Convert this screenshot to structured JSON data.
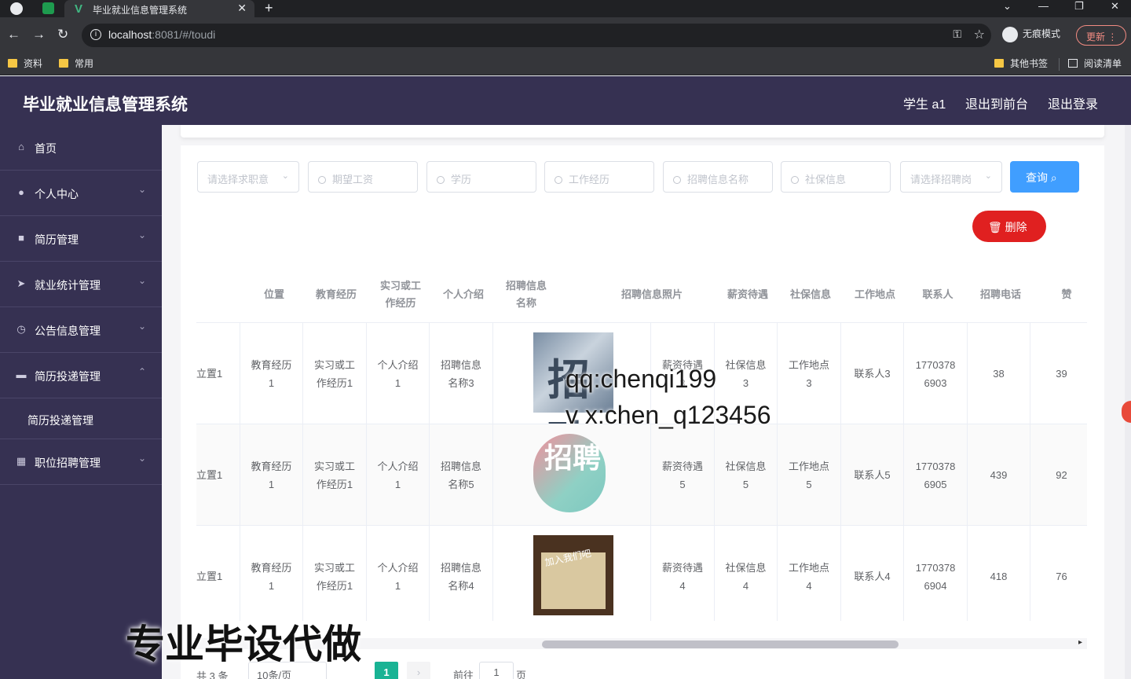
{
  "browser": {
    "tab_title": "毕业就业信息管理系统",
    "url_host": "localhost",
    "url_rest": ":8081/#/toudi",
    "incognito_label": "无痕模式",
    "update_label": "更新",
    "bookmarks": [
      "资料",
      "常用"
    ],
    "bookmarks_right": [
      "其他书签",
      "阅读清单"
    ]
  },
  "header": {
    "title": "毕业就业信息管理系统",
    "user": "学生 a1",
    "to_front": "退出到前台",
    "logout": "退出登录"
  },
  "sidebar": {
    "items": [
      {
        "label": "首页",
        "icon": "home-icon"
      },
      {
        "label": "个人中心",
        "icon": "user-icon"
      },
      {
        "label": "简历管理",
        "icon": "document-icon"
      },
      {
        "label": "就业统计管理",
        "icon": "send-icon"
      },
      {
        "label": "公告信息管理",
        "icon": "clock-icon"
      },
      {
        "label": "简历投递管理",
        "icon": "inbox-icon"
      },
      {
        "label": "简历投递管理",
        "icon": ""
      },
      {
        "label": "职位招聘管理",
        "icon": "grid-icon"
      }
    ]
  },
  "search": {
    "fields": [
      "请选择求职意",
      "期望工资",
      "学历",
      "工作经历",
      "招聘信息名称",
      "社保信息",
      "请选择招聘岗"
    ],
    "query_label": "查询",
    "delete_label": "删除"
  },
  "table": {
    "headers": [
      "位置",
      "教育经历",
      "实习或工\n作经历",
      "个人介绍",
      "招聘信息\n名称",
      "招聘信息照片",
      "薪资待遇",
      "社保信息",
      "工作地点",
      "联系人",
      "招聘电话",
      "赞"
    ],
    "rows": [
      {
        "pos": "立置1",
        "edu": "教育经历\n1",
        "work": "实习或工\n作经历1",
        "intro": "个人介绍\n1",
        "name": "招聘信息\n名称3",
        "photo_text": "招聘",
        "salary": "薪资待遇\n3",
        "social": "社保信息\n3",
        "place": "工作地点\n3",
        "contact": "联系人3",
        "phone": "1770378\n6903",
        "n1": "38",
        "n2": "39"
      },
      {
        "pos": "立置1",
        "edu": "教育经历\n1",
        "work": "实习或工\n作经历1",
        "intro": "个人介绍\n1",
        "name": "招聘信息\n名称5",
        "photo_text": "招聘",
        "salary": "薪资待遇\n5",
        "social": "社保信息\n5",
        "place": "工作地点\n5",
        "contact": "联系人5",
        "phone": "1770378\n6905",
        "n1": "439",
        "n2": "92"
      },
      {
        "pos": "立置1",
        "edu": "教育经历\n1",
        "work": "实习或工\n作经历1",
        "intro": "个人介绍\n1",
        "name": "招聘信息\n名称4",
        "photo_text": "加入我们吧",
        "salary": "薪资待遇\n4",
        "social": "社保信息\n4",
        "place": "工作地点\n4",
        "contact": "联系人4",
        "phone": "1770378\n6904",
        "n1": "418",
        "n2": "76"
      }
    ]
  },
  "pagination": {
    "total": "共 3 条",
    "size": "10条/页",
    "current": "1",
    "goto": "前往",
    "goto_value": "1",
    "unit": "页"
  },
  "watermarks": {
    "line1": "qq:chenqi199",
    "line2": "v x:chen_q123456",
    "banner": "专业毕设代做"
  }
}
